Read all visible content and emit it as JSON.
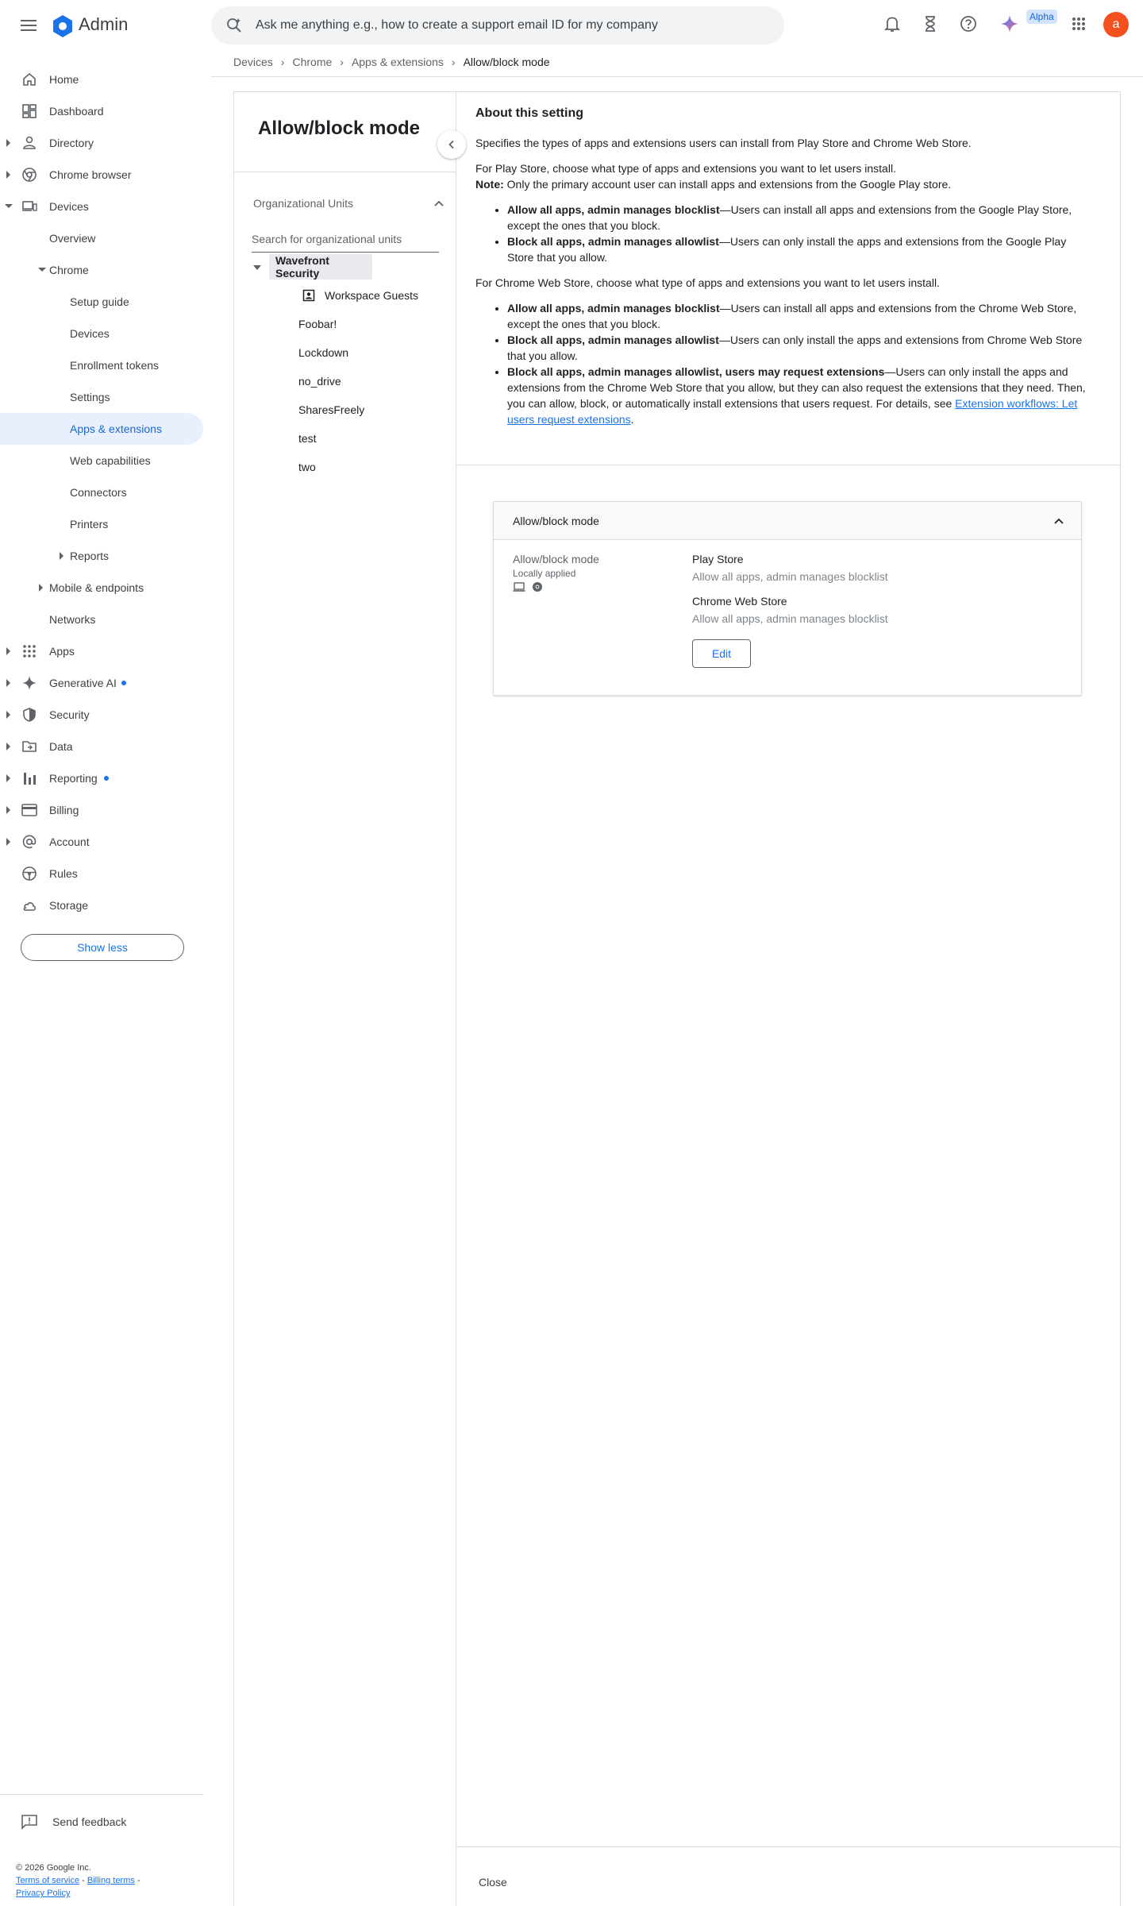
{
  "app": {
    "name": "Admin"
  },
  "search": {
    "placeholder": "Ask me anything e.g., how to create a support email ID for my company"
  },
  "topbar": {
    "alpha_label": "Alpha",
    "avatar_letter": "a"
  },
  "breadcrumb": [
    "Devices",
    "Chrome",
    "Apps & extensions",
    "Allow/block mode"
  ],
  "sidebar": {
    "items": [
      {
        "label": "Home"
      },
      {
        "label": "Dashboard"
      },
      {
        "label": "Directory"
      },
      {
        "label": "Chrome browser"
      },
      {
        "label": "Devices"
      },
      {
        "label": "Overview"
      },
      {
        "label": "Chrome"
      },
      {
        "label": "Setup guide"
      },
      {
        "label": "Devices"
      },
      {
        "label": "Enrollment tokens"
      },
      {
        "label": "Settings"
      },
      {
        "label": "Apps & extensions"
      },
      {
        "label": "Web capabilities"
      },
      {
        "label": "Connectors"
      },
      {
        "label": "Printers"
      },
      {
        "label": "Reports"
      },
      {
        "label": "Mobile & endpoints"
      },
      {
        "label": "Networks"
      },
      {
        "label": "Apps"
      },
      {
        "label": "Generative AI"
      },
      {
        "label": "Security"
      },
      {
        "label": "Data"
      },
      {
        "label": "Reporting"
      },
      {
        "label": "Billing"
      },
      {
        "label": "Account"
      },
      {
        "label": "Rules"
      },
      {
        "label": "Storage"
      }
    ],
    "show_less": "Show less",
    "send_feedback": "Send feedback",
    "copyright": "© 2026 Google Inc.",
    "terms": "Terms of service",
    "billing_terms": "Billing terms",
    "privacy": "Privacy Policy",
    "legal_sep": " - "
  },
  "panel": {
    "title": "Allow/block mode",
    "ou_header": "Organizational Units",
    "ou_search_placeholder": "Search for organizational units",
    "ou_root": "Wavefront Security",
    "ou_children": [
      "Workspace Guests",
      "Foobar!",
      "Lockdown",
      "no_drive",
      "SharesFreely",
      "test",
      "two"
    ]
  },
  "about": {
    "title": "About this setting",
    "intro": "Specifies the types of apps and extensions users can install from Play Store and Chrome Web Store.",
    "play_intro": "For Play Store, choose what type of apps and extensions you want to let users install.",
    "note_label": "Note:",
    "note_text": " Only the primary account user can install apps and extensions from the Google Play store.",
    "play_opt1_bold": "Allow all apps, admin manages blocklist",
    "play_opt1_text": "—Users can install all apps and extensions from the Google Play Store, except the ones that you block.",
    "play_opt2_bold": "Block all apps, admin manages allowlist",
    "play_opt2_text": "—Users can only install the apps and extensions from the Google Play Store that you allow.",
    "cws_intro": "For Chrome Web Store, choose what type of apps and extensions you want to let users install.",
    "cws_opt1_bold": "Allow all apps, admin manages blocklist",
    "cws_opt1_text": "—Users can install all apps and extensions from the Chrome Web Store, except the ones that you block.",
    "cws_opt2_bold": "Block all apps, admin manages allowlist",
    "cws_opt2_text": "—Users can only install the apps and extensions from Chrome Web Store that you allow.",
    "cws_opt3_bold": "Block all apps, admin manages allowlist, users may request extensions",
    "cws_opt3_text": "—Users can only install the apps and extensions from the Chrome Web Store that you allow, but they can also request the extensions that they need. Then, you can allow, block, or automatically install extensions that users request. For details, see ",
    "cws_opt3_link": "Extension workflows: Let users request extensions",
    "cws_opt3_end": "."
  },
  "card": {
    "header": "Allow/block mode",
    "label": "Allow/block mode",
    "sub": "Locally applied",
    "play_name": "Play Store",
    "play_value": "Allow all apps, admin manages blocklist",
    "cws_name": "Chrome Web Store",
    "cws_value": "Allow all apps, admin manages blocklist",
    "edit": "Edit"
  },
  "close_label": "Close",
  "colors": {
    "accent": "#1a73e8",
    "avatar": "#f4511e",
    "selected_bg": "#e8f0fe"
  },
  "icons": [
    "menu-icon",
    "admin-logo-icon",
    "search-sparkle-icon",
    "bell-icon",
    "hourglass-icon",
    "help-icon",
    "gemini-icon",
    "apps-grid-icon"
  ]
}
